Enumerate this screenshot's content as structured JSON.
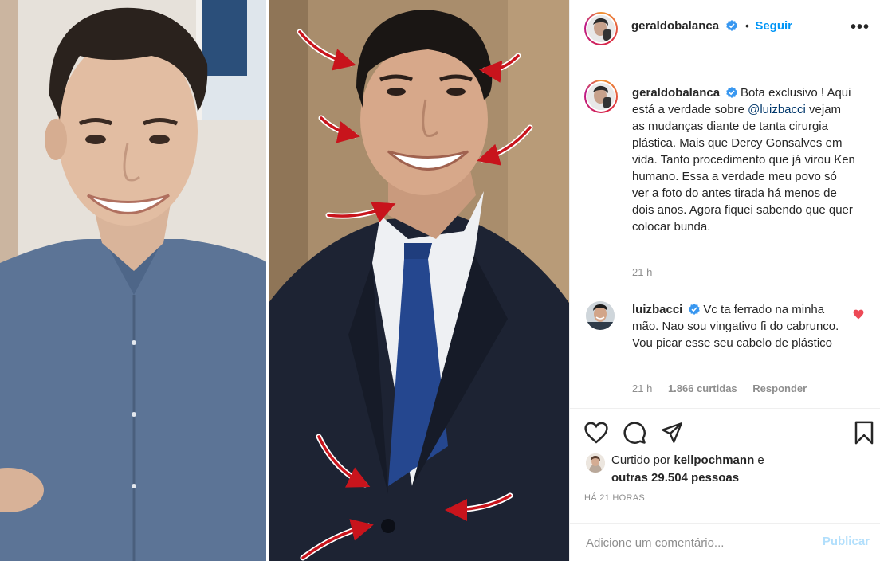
{
  "post": {
    "author": "geraldobalanca",
    "follow_dot": "•",
    "follow_label": "Seguir",
    "more_label": "•••"
  },
  "caption": {
    "author": "geraldobalanca",
    "text_before_mention": "Bota exclusivo ! Aqui está a verdade sobre ",
    "mention": "@luizbacci",
    "text_after_mention": " vejam as mudanças diante de tanta cirurgia plástica. Mais que Dercy Gonsalves em vida. Tanto procedimento que já virou Ken humano. Essa a verdade meu povo só ver a foto do antes tirada há menos de dois anos. Agora fiquei sabendo que quer colocar bunda.",
    "time": "21 h"
  },
  "comment": {
    "author": "luizbacci",
    "text": "Vc ta ferrado na minha mão. Nao sou vingativo fi do cabrunco. Vou picar esse seu cabelo de plástico",
    "time": "21 h",
    "likes": "1.866 curtidas",
    "reply": "Responder"
  },
  "likes": {
    "prefix": "Curtido por ",
    "first_user": "kellpochmann",
    "middle": " e",
    "others": "outras 29.504 pessoas"
  },
  "timestamp": "HÁ 21 HORAS",
  "add_comment": {
    "placeholder": "Adicione um comentário...",
    "publish_label": "Publicar"
  },
  "colors": {
    "link_blue": "#0095f6",
    "mention_blue": "#00376b",
    "muted_gray": "#8e8e8e",
    "heart_red": "#ed4956",
    "arrow_red": "#c8141c",
    "publish_disabled": "#b2dffc"
  },
  "icons": {
    "verified": "verified-badge-icon",
    "like": "heart-icon",
    "comment": "comment-bubble-icon",
    "share": "paper-plane-icon",
    "save": "bookmark-icon",
    "comment_like": "heart-filled-icon"
  }
}
